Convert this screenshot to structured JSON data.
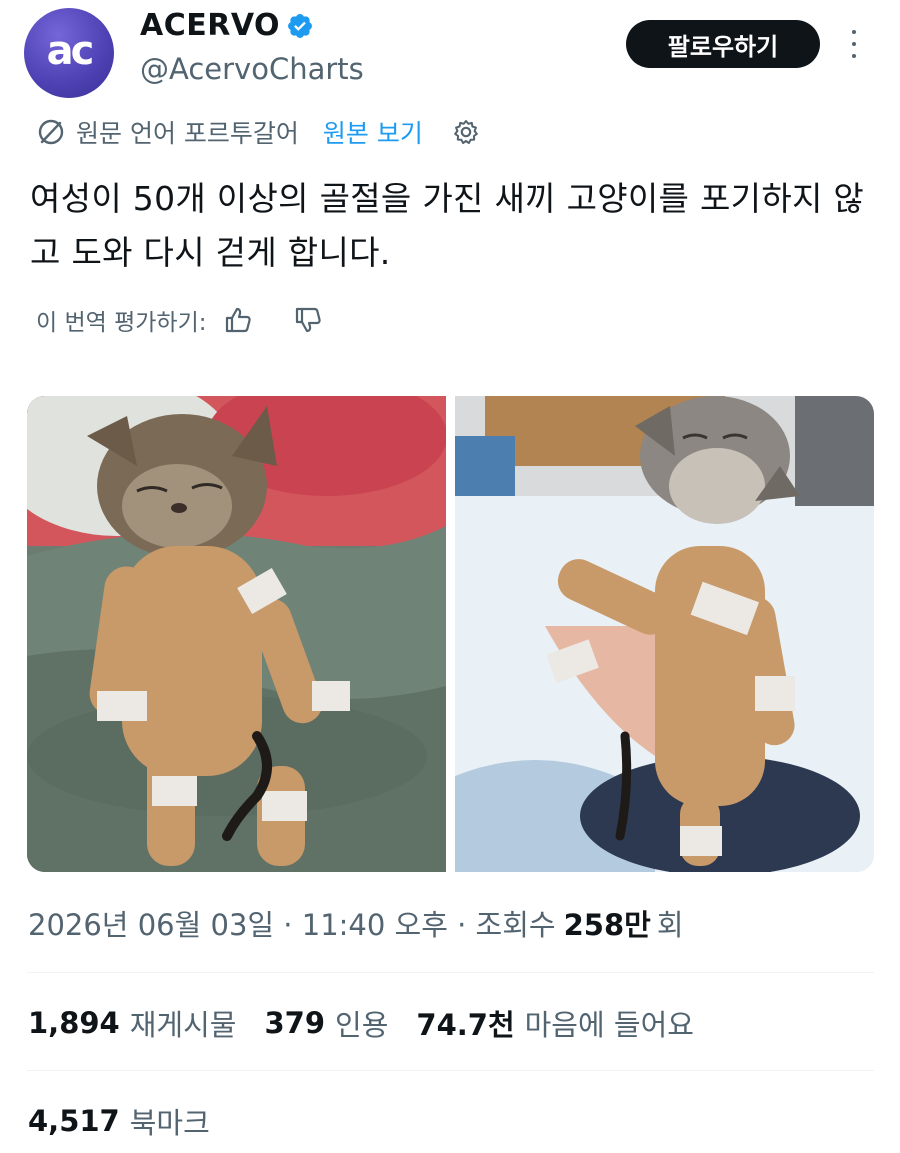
{
  "author": {
    "avatar_text": "ac",
    "name": "ACERVO",
    "handle": "@AcervoCharts",
    "verified": true
  },
  "header": {
    "follow_label": "팔로우하기"
  },
  "translation": {
    "source_label": "원문 언어 포르투갈어",
    "show_original_label": "원본 보기"
  },
  "tweet": {
    "text": "여성이 50개 이상의 골절을 가진 새끼 고양이를 포기하지 않고 도와 다시 걷게 합니다."
  },
  "rating": {
    "label": "이 번역 평가하기:"
  },
  "meta": {
    "date": "2026년 06월 03일 · 11:40 오후 · 조회수",
    "views_count": "258만",
    "views_suffix": "회"
  },
  "stats": {
    "reposts_count": "1,894",
    "reposts_label": "재게시물",
    "quotes_count": "379",
    "quotes_label": "인용",
    "likes_count": "74.7천",
    "likes_label": "마음에 들어요",
    "bookmarks_count": "4,517",
    "bookmarks_label": "북마크"
  },
  "colors": {
    "link": "#1d9bf0",
    "text_primary": "#0f1419",
    "text_secondary": "#536471",
    "follow_button_bg": "#0f1419",
    "avatar_bg": "#4f43b6"
  },
  "icons": {
    "translate": "translate-icon",
    "settings": "gear-icon",
    "thumbs_up": "thumbs-up-icon",
    "thumbs_down": "thumbs-down-icon",
    "verified": "verified-badge-icon",
    "more": "more-vertical-icon"
  }
}
